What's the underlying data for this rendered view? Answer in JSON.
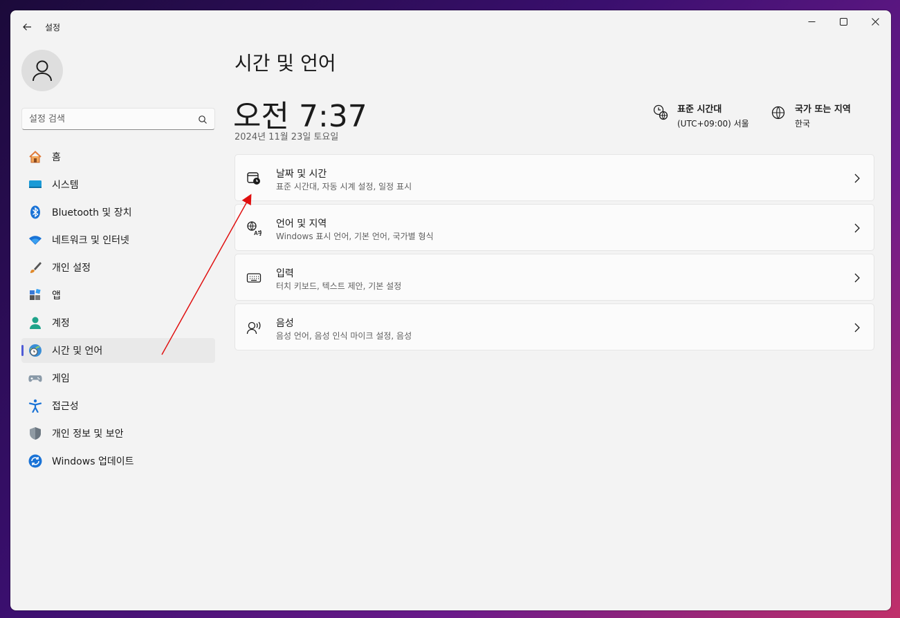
{
  "window": {
    "title": "설정"
  },
  "search": {
    "placeholder": "설정 검색"
  },
  "sidebar": {
    "items": [
      {
        "label": "홈",
        "icon": "home-icon"
      },
      {
        "label": "시스템",
        "icon": "system-icon"
      },
      {
        "label": "Bluetooth 및 장치",
        "icon": "bluetooth-icon"
      },
      {
        "label": "네트워크 및 인터넷",
        "icon": "wifi-icon"
      },
      {
        "label": "개인 설정",
        "icon": "brush-icon"
      },
      {
        "label": "앱",
        "icon": "apps-icon"
      },
      {
        "label": "계정",
        "icon": "account-icon"
      },
      {
        "label": "시간 및 언어",
        "icon": "time-language-icon",
        "active": true
      },
      {
        "label": "게임",
        "icon": "gamepad-icon"
      },
      {
        "label": "접근성",
        "icon": "accessibility-icon"
      },
      {
        "label": "개인 정보 및 보안",
        "icon": "shield-icon"
      },
      {
        "label": "Windows 업데이트",
        "icon": "update-icon"
      }
    ]
  },
  "main": {
    "title": "시간 및 언어",
    "clock": "오전 7:37",
    "date": "2024년 11월 23일 토요일",
    "timezone": {
      "title": "표준 시간대",
      "value": "(UTC+09:00) 서울"
    },
    "region": {
      "title": "국가 또는 지역",
      "value": "한국"
    },
    "cards": [
      {
        "title": "날짜 및 시간",
        "subtitle": "표준 시간대, 자동 시계 설정, 일정 표시",
        "icon": "calendar-clock-icon"
      },
      {
        "title": "언어 및 지역",
        "subtitle": "Windows 표시 언어, 기본 언어, 국가별 형식",
        "icon": "language-icon"
      },
      {
        "title": "입력",
        "subtitle": "터치 키보드, 텍스트 제안, 기본 설정",
        "icon": "keyboard-icon"
      },
      {
        "title": "음성",
        "subtitle": "음성 언어, 음성 인식 마이크 설정, 음성",
        "icon": "speech-icon"
      }
    ]
  },
  "colors": {
    "accent": "#4f5bd5",
    "annotation": "#e01010",
    "window_bg": "#f3f3f3"
  }
}
